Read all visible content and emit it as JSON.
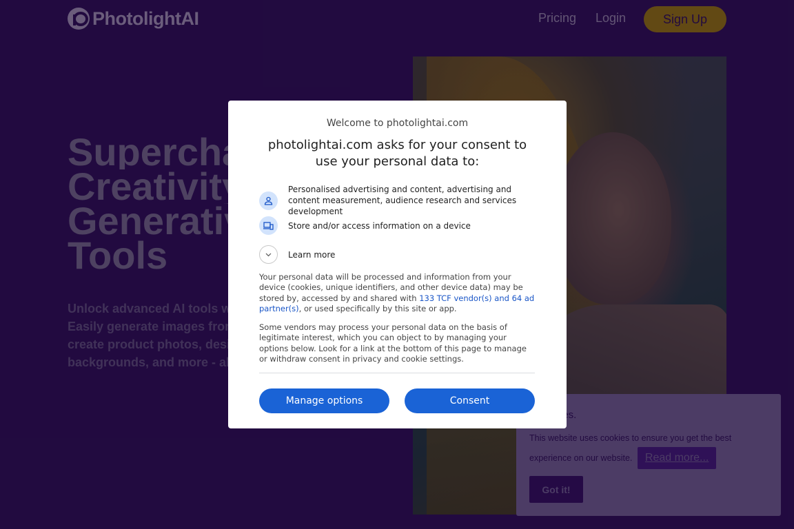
{
  "header": {
    "logo_text": "PhotolightAI",
    "nav": {
      "pricing": "Pricing",
      "login": "Login",
      "signup": "Sign Up"
    }
  },
  "hero": {
    "title_lines": [
      "Supercharge",
      "Creativity",
      "Generative",
      "Tools"
    ],
    "subtitle_lines": [
      "Unlock advanced AI tools with",
      "Easily generate images from",
      "create product photos, design",
      "backgrounds, and more - all in"
    ]
  },
  "consent_modal": {
    "welcome": "Welcome to photolightai.com",
    "heading": "photolightai.com asks for your consent to use your personal data to:",
    "purposes": [
      {
        "icon": "person-icon",
        "text": "Personalised advertising and content, advertising and content measurement, audience research and services development"
      },
      {
        "icon": "devices-icon",
        "text": "Store and/or access information on a device"
      }
    ],
    "learn_more": "Learn more",
    "para1_before": "Your personal data will be processed and information from your device (cookies, unique identifiers, and other device data) may be stored by, accessed by and shared with ",
    "para1_link": "133 TCF vendor(s) and 64 ad partner(s)",
    "para1_after": ", or used specifically by this site or app.",
    "para2": "Some vendors may process your personal data on the basis of legitimate interest, which you can object to by managing your options below. Look for a link at the bottom of this page to manage or withdraw consent in privacy and cookie settings.",
    "manage_button": "Manage options",
    "consent_button": "Consent"
  },
  "cookie_banner": {
    "title": "ies.",
    "text": "This website uses cookies to ensure you get the best experience on our website.",
    "read_more": "Read more...",
    "got_it": "Got it!"
  },
  "colors": {
    "page_bg": "#2a0d4d",
    "accent_yellow": "#8c6e0a",
    "primary_blue": "#1a63d6",
    "cookie_bg": "#6a5a86"
  }
}
